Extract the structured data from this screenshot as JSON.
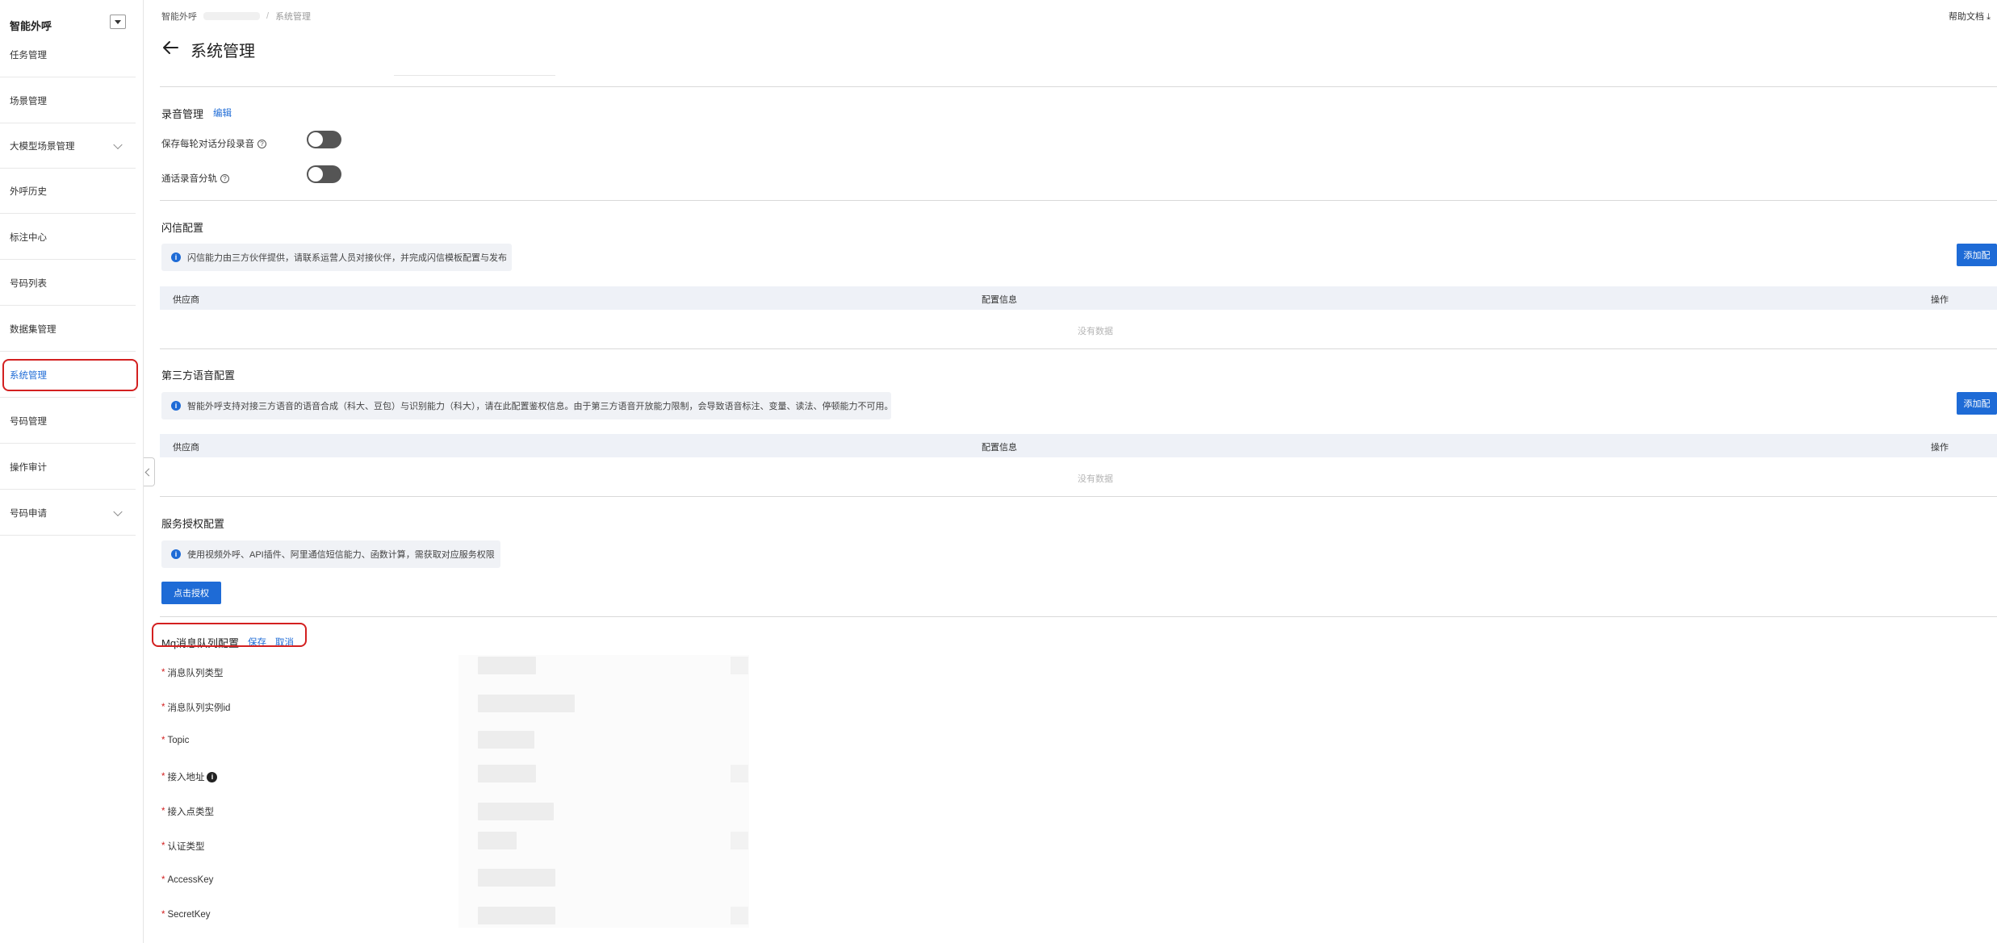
{
  "sidebar": {
    "title": "智能外呼",
    "items": [
      {
        "label": "任务管理",
        "expandable": false
      },
      {
        "label": "场景管理",
        "expandable": false
      },
      {
        "label": "大模型场景管理",
        "expandable": true
      },
      {
        "label": "外呼历史",
        "expandable": false
      },
      {
        "label": "标注中心",
        "expandable": false
      },
      {
        "label": "号码列表",
        "expandable": false
      },
      {
        "label": "数据集管理",
        "expandable": false
      },
      {
        "label": "系统管理",
        "expandable": false,
        "active": true
      },
      {
        "label": "号码管理",
        "expandable": false
      },
      {
        "label": "操作审计",
        "expandable": false
      },
      {
        "label": "号码申请",
        "expandable": true
      }
    ]
  },
  "header": {
    "breadcrumb_root": "智能外呼",
    "breadcrumb_sep": "/",
    "breadcrumb_current": "系统管理",
    "help_label": "帮助文档",
    "page_title": "系统管理"
  },
  "recording": {
    "title": "录音管理",
    "edit_label": "编辑",
    "options": [
      {
        "label": "保存每轮对话分段录音",
        "enabled": false
      },
      {
        "label": "通话录音分轨",
        "enabled": false
      }
    ]
  },
  "flash_sms": {
    "title": "闪信配置",
    "notice": "闪信能力由三方伙伴提供，请联系运营人员对接伙伴，并完成闪信模板配置与发布",
    "add_label": "添加配",
    "columns": [
      "供应商",
      "配置信息",
      "操作"
    ],
    "empty_text": "没有数据"
  },
  "third_party_voice": {
    "title": "第三方语音配置",
    "notice": "智能外呼支持对接三方语音的语音合成（科大、豆包）与识别能力（科大），请在此配置鉴权信息。由于第三方语音开放能力限制，会导致语音标注、变量、读法、停顿能力不可用。",
    "add_label": "添加配",
    "columns": [
      "供应商",
      "配置信息",
      "操作"
    ],
    "empty_text": "没有数据"
  },
  "service_auth": {
    "title": "服务授权配置",
    "notice": "使用视频外呼、API插件、阿里通信短信能力、函数计算，需获取对应服务权限",
    "button_label": "点击授权"
  },
  "mq_config": {
    "title": "Mq消息队列配置",
    "save_label": "保存",
    "cancel_label": "取消",
    "fields": [
      {
        "label": "消息队列类型",
        "info": false
      },
      {
        "label": "消息队列实例id",
        "info": false
      },
      {
        "label": "Topic",
        "info": false
      },
      {
        "label": "接入地址",
        "info": true
      },
      {
        "label": "接入点类型",
        "info": false
      },
      {
        "label": "认证类型",
        "info": false
      },
      {
        "label": "AccessKey",
        "info": false
      },
      {
        "label": "SecretKey",
        "info": false
      }
    ]
  },
  "colors": {
    "accent": "#1e6bd6",
    "highlight": "#d32020",
    "switch_off": "#555555"
  }
}
